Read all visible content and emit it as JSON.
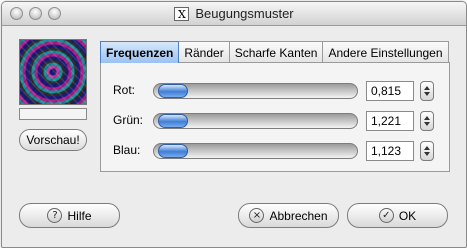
{
  "window": {
    "title": "Beugungsmuster",
    "title_icon": "X"
  },
  "preview": {
    "button_label": "Vorschau!",
    "progress_percent": 0
  },
  "tabs": [
    {
      "label": "Frequenzen",
      "active": true
    },
    {
      "label": "Ränder",
      "active": false
    },
    {
      "label": "Scharfe Kanten",
      "active": false
    },
    {
      "label": "Andere Einstellungen",
      "active": false
    }
  ],
  "rows": [
    {
      "label": "Rot:",
      "value": "0,815",
      "slider_fraction": 0.0
    },
    {
      "label": "Grün:",
      "value": "1,221",
      "slider_fraction": 0.0
    },
    {
      "label": "Blau:",
      "value": "1,123",
      "slider_fraction": 0.0
    }
  ],
  "buttons": {
    "help": {
      "label": "Hilfe",
      "icon": "?"
    },
    "cancel": {
      "label": "Abbrechen",
      "icon": "×"
    },
    "ok": {
      "label": "OK",
      "icon": "✓"
    }
  },
  "colors": {
    "accent": "#3f7fd6",
    "window_bg": "#ececec"
  }
}
